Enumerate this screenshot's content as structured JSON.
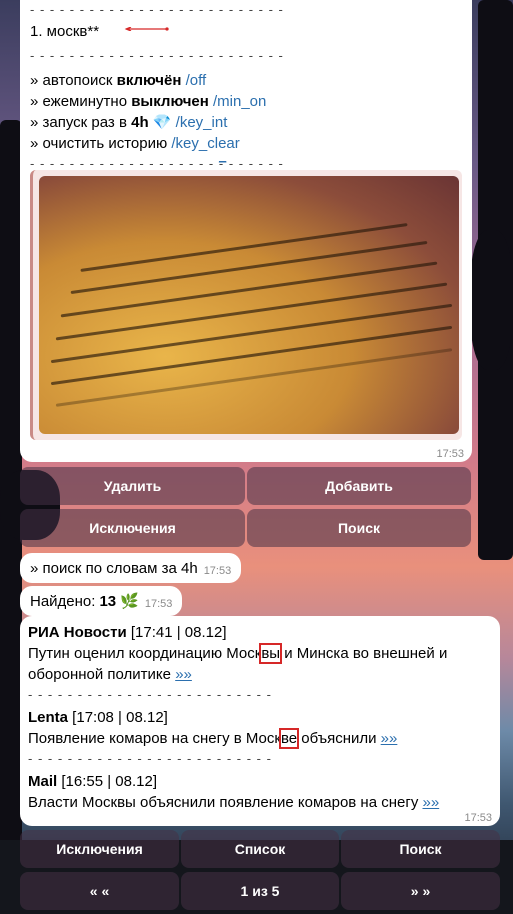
{
  "top_message": {
    "result_line": "1. москв**",
    "rows": [
      {
        "prefix": "» автопоиск ",
        "bold": "включён",
        "cmd": " /off"
      },
      {
        "prefix": "» ежеминутно ",
        "bold": "выключен",
        "cmd": " /min_on"
      },
      {
        "prefix": "» запуск раз в ",
        "bold": "4h",
        "icon": "💎",
        "cmd": " /key_int"
      },
      {
        "prefix": "» очистить историю ",
        "bold": "",
        "cmd": " /key_clear"
      }
    ],
    "dash_line": "- - - - - - - - - - - - - - - - - - - - - - - - - -",
    "dash_line_short": "- - - - - - - - - - - - - - - - - - - - - - - - - -",
    "dash_link": "_",
    "time": "17:53"
  },
  "keyboard1": {
    "delete": "Удалить",
    "add": "Добавить",
    "exclusions": "Исключения",
    "search": "Поиск"
  },
  "search_msg": {
    "text": "» поиск по словам за 4h",
    "time": "17:53"
  },
  "found_msg": {
    "label": "Найдено: ",
    "count": "13",
    "icon": "🌿",
    "time": "17:53"
  },
  "news": {
    "items": [
      {
        "source": "РИА Новости",
        "meta": " [17:41 | 08.12]",
        "text_a": "Путин оценил координацию Моск",
        "hl": "вы",
        "text_b": " и Минска во внешней и оборонной политике ",
        "more": "»»"
      },
      {
        "source": "Lenta",
        "meta": " [17:08 | 08.12]",
        "text_a": "Появление комаров на снегу в Моск",
        "hl": "ве",
        "text_b": " объяснили ",
        "more": "»»"
      },
      {
        "source": "Mail",
        "meta": " [16:55 | 08.12]",
        "text_a": "Власти Москвы объяснили появление комаров на снегу ",
        "hl": "",
        "text_b": "",
        "more": "»»"
      }
    ],
    "dash_line": "- - - - - - - - - - - - - - - - - - - - - - - - -",
    "time": "17:53"
  },
  "keyboard2": {
    "exclusions": "Исключения",
    "list": "Список",
    "search": "Поиск",
    "prev": "« «",
    "page": "1 из 5",
    "next": "» »"
  },
  "colors": {
    "link": "#2b6fae",
    "highlight": "#d62828"
  }
}
